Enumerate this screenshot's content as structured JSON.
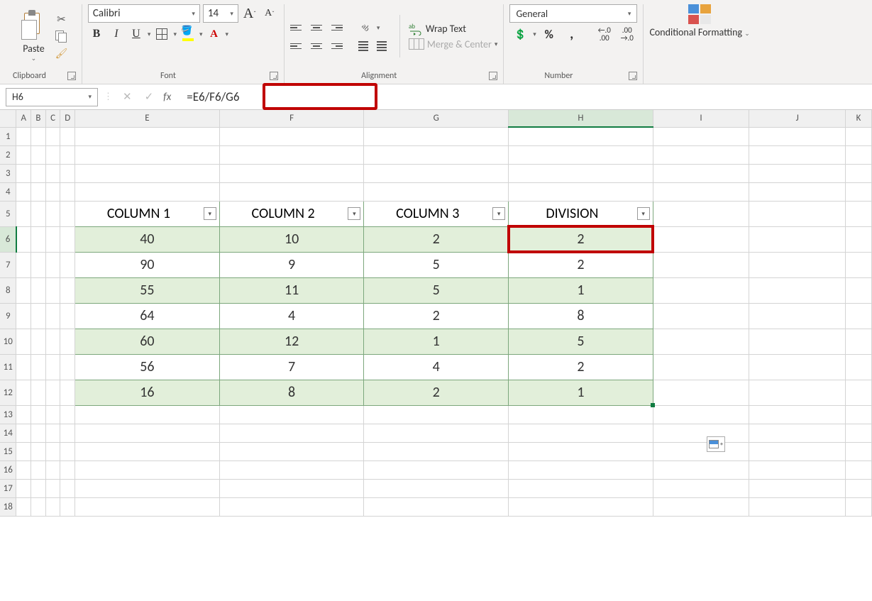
{
  "ribbon": {
    "clipboard": {
      "paste": "Paste",
      "label": "Clipboard"
    },
    "font": {
      "name": "Calibri",
      "size": "14",
      "label": "Font",
      "bold": "B",
      "italic": "I",
      "underline": "U",
      "color_a": "A"
    },
    "alignment": {
      "label": "Alignment",
      "wrap": "Wrap Text",
      "merge": "Merge & Center"
    },
    "number": {
      "label": "Number",
      "format": "General"
    },
    "cond": {
      "label": "Conditional Formatting"
    }
  },
  "fbar": {
    "cell": "H6",
    "fx": "fx",
    "formula": "=E6/F6/G6"
  },
  "cols": [
    "",
    "A",
    "B",
    "C",
    "D",
    "E",
    "F",
    "G",
    "H",
    "I",
    "J",
    "K"
  ],
  "table": {
    "headers": [
      "COLUMN 1",
      "COLUMN 2",
      "COLUMN 3",
      "DIVISION"
    ],
    "rows": [
      [
        40,
        10,
        2,
        2
      ],
      [
        90,
        9,
        5,
        2
      ],
      [
        55,
        11,
        5,
        1
      ],
      [
        64,
        4,
        2,
        8
      ],
      [
        60,
        12,
        1,
        5
      ],
      [
        56,
        7,
        4,
        2
      ],
      [
        16,
        8,
        2,
        1
      ]
    ]
  },
  "row_labels": [
    "1",
    "2",
    "3",
    "4",
    "5",
    "6",
    "7",
    "8",
    "9",
    "10",
    "11",
    "12",
    "13",
    "14",
    "15",
    "16",
    "17",
    "18"
  ],
  "glyphs": {
    "dd": "▾",
    "x": "✕",
    "chk": "✓",
    "chevron": "⌄",
    "plus": "+"
  }
}
